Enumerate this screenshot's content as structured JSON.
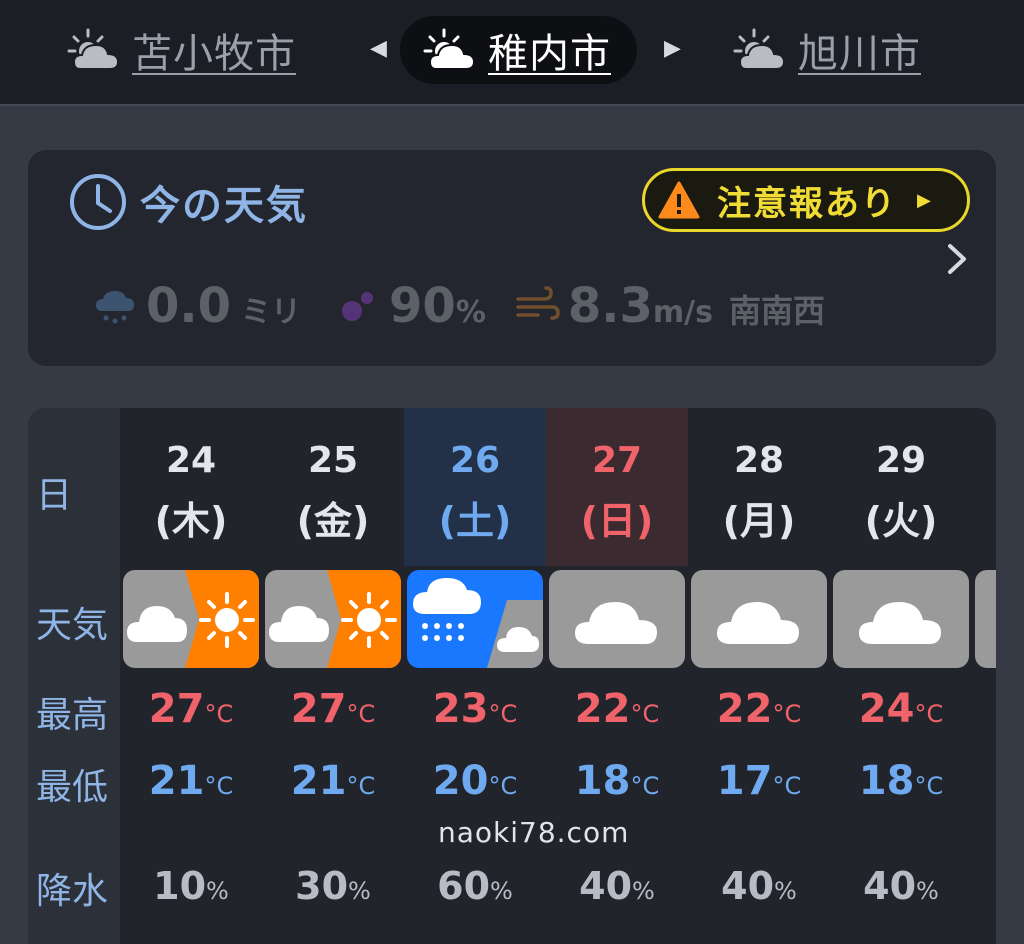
{
  "cities": {
    "prev": {
      "name": "苫小牧市",
      "icon": "sun-cloud-icon"
    },
    "current": {
      "name": "稚内市",
      "icon": "sun-cloud-icon"
    },
    "next": {
      "name": "旭川市",
      "icon": "sun-cloud-icon"
    }
  },
  "now": {
    "title": "今の天気",
    "alert": "注意報あり",
    "precip_value": "0.0",
    "precip_unit": "ミリ",
    "humidity_value": "90",
    "humidity_unit": "%",
    "wind_value": "8.3",
    "wind_unit": "m/s",
    "wind_dir": "南南西"
  },
  "labels": {
    "day": "日",
    "weather": "天気",
    "high": "最高",
    "low": "最低",
    "rain": "降水"
  },
  "temp_unit": "°C",
  "rain_unit": "%",
  "days": [
    {
      "date": "24",
      "weekday": "(木)",
      "weather": "cloudy-then-sunny",
      "high": "27",
      "low": "21",
      "rain": "10"
    },
    {
      "date": "25",
      "weekday": "(金)",
      "weather": "cloudy-then-sunny",
      "high": "27",
      "low": "21",
      "rain": "30"
    },
    {
      "date": "26",
      "weekday": "(土)",
      "weather": "rain-then-cloudy",
      "high": "23",
      "low": "20",
      "rain": "60"
    },
    {
      "date": "27",
      "weekday": "(日)",
      "weather": "cloudy",
      "high": "22",
      "low": "18",
      "rain": "40"
    },
    {
      "date": "28",
      "weekday": "(月)",
      "weather": "cloudy",
      "high": "22",
      "low": "17",
      "rain": "40"
    },
    {
      "date": "29",
      "weekday": "(火)",
      "weather": "cloudy",
      "high": "24",
      "low": "18",
      "rain": "40"
    }
  ],
  "watermark": "naoki78.com",
  "colors": {
    "accent_blue": "#8fb5e6",
    "high_red": "#f0636b",
    "low_blue": "#6fa9ef",
    "alert_yellow": "#f0dc35",
    "sunny_orange": "#ff7f00",
    "rain_blue": "#1a78ff",
    "cloudy_gray": "#9a9a9a"
  }
}
